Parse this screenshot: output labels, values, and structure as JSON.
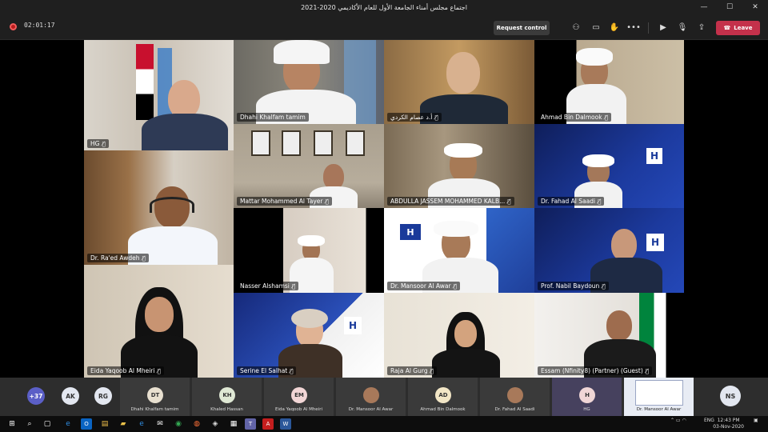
{
  "window": {
    "title": "اجتماع مجلس أمناء الجامعة الأول للعام الأكاديمي 2020-2021",
    "minimize": "—",
    "maximize": "☐",
    "close": "✕"
  },
  "toolbar": {
    "timer": "02:01:17",
    "request_control": "Request control",
    "leave": "Leave",
    "leave_color": "#c4314b"
  },
  "tiles": [
    {
      "name": "HG",
      "muted": true
    },
    {
      "name": "Dhahi  Khalfam tamim",
      "muted": false
    },
    {
      "name": "أ.د عصام  الكردي",
      "muted": true
    },
    {
      "name": "Ahmad Bin Dalmook",
      "muted": true
    },
    {
      "name": "Dr. Ra'ed Awdeh",
      "muted": true
    },
    {
      "name": "Mattar Mohammed Al Tayer",
      "muted": true
    },
    {
      "name": "ABDULLA JASSEM MOHAMMED KALB...",
      "muted": true
    },
    {
      "name": "Dr. Fahad Al Saadi",
      "muted": true
    },
    {
      "name": "Nasser Alshamsi",
      "muted": true
    },
    {
      "name": "Dr. Mansoor Al Awar",
      "muted": true
    },
    {
      "name": "Prof. Nabil Baydoun",
      "muted": true
    },
    {
      "name": "Eida Yaqoob Al Mheiri",
      "muted": true
    },
    {
      "name": "Serine El Salhat",
      "muted": true
    },
    {
      "name": "Raja Al Gurg",
      "muted": true
    },
    {
      "name": "Essam (Nfinity8) (Partner) (Guest)",
      "muted": true
    }
  ],
  "strip": {
    "more_count": "+37",
    "chips": [
      "AK",
      "RG"
    ],
    "participants": [
      {
        "initials": "DT",
        "name": "Dhahi Khalfam tamim"
      },
      {
        "initials": "KH",
        "name": "Khaled Hassan"
      },
      {
        "initials": "EM",
        "name": "Eida Yaqoob Al Mheiri"
      },
      {
        "initials": "",
        "name": "Dr. Mansoor Al Awar"
      },
      {
        "initials": "AD",
        "name": "Ahmad Bin Dalmook"
      },
      {
        "initials": "",
        "name": "Dr. Fahad Al Saadi"
      },
      {
        "initials": "H",
        "name": "HG"
      },
      {
        "initials": "",
        "name": "Dr. Mansoor Al Awar"
      }
    ],
    "self": "NS"
  },
  "taskbar": {
    "language": "ENG",
    "time": "12:43 PM",
    "date": "03-Nov-2020"
  }
}
